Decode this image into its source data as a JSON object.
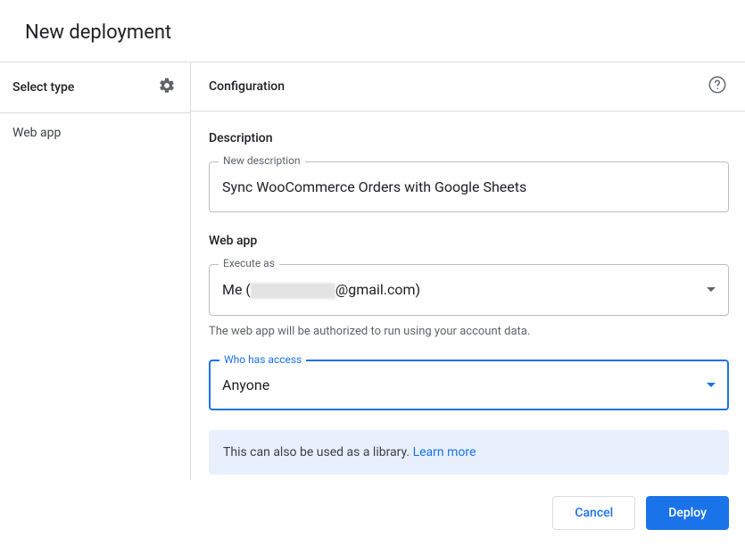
{
  "header": {
    "title": "New deployment"
  },
  "sidebar": {
    "title": "Select type",
    "items": [
      {
        "label": "Web app"
      }
    ]
  },
  "content": {
    "title": "Configuration",
    "description": {
      "heading": "Description",
      "legend": "New description",
      "value": "Sync WooCommerce Orders with Google Sheets"
    },
    "webapp": {
      "heading": "Web app",
      "execute_as": {
        "legend": "Execute as",
        "value_prefix": "Me (",
        "value_suffix": "@gmail.com)",
        "helper": "The web app will be authorized to run using your account data."
      },
      "access": {
        "legend": "Who has access",
        "value": "Anyone"
      }
    },
    "info": {
      "text": "This can also be used as a library. ",
      "link": "Learn more"
    }
  },
  "footer": {
    "cancel": "Cancel",
    "deploy": "Deploy"
  }
}
